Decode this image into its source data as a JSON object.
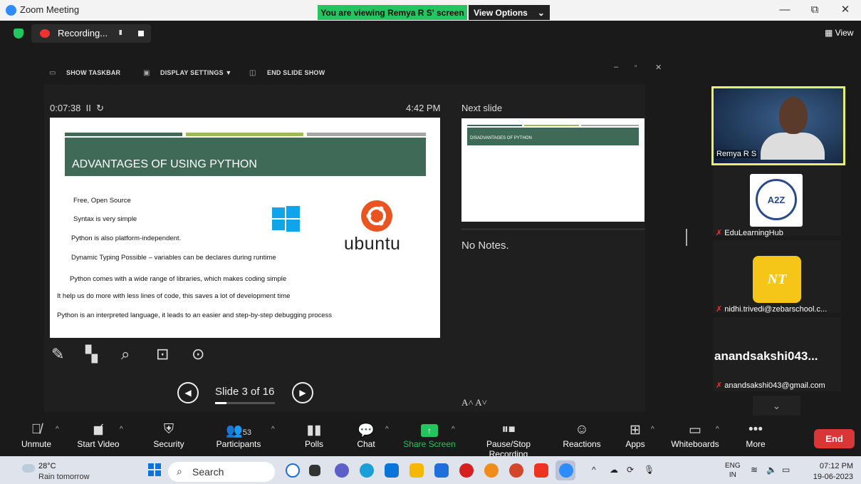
{
  "window": {
    "title": "Zoom Meeting",
    "viewing_banner": "You are viewing Remya R S' screen",
    "view_options": "View Options"
  },
  "recording": {
    "label": "Recording...",
    "pause": "II"
  },
  "view_button": "View",
  "presenter_toolbar": {
    "show_taskbar": "SHOW TASKBAR",
    "display_settings": "DISPLAY SETTINGS ▼",
    "end_slide_show": "END SLIDE SHOW"
  },
  "presenter": {
    "elapsed": "0:07:38",
    "clock": "4:42 PM",
    "next_slide_label": "Next slide",
    "notes": "No Notes.",
    "font_size_control": "A˄ A˅",
    "slide_counter": "Slide 3 of 16",
    "progress_fraction": 0.1875
  },
  "slide": {
    "title": "ADVANTAGES OF USING PYTHON",
    "bullets": [
      "Free, Open Source",
      "Syntax is very simple",
      "Python is also platform-independent.",
      "Dynamic Typing Possible – variables can be declares during runtime",
      "Python comes with a wide range of libraries, which makes coding simple",
      "It help us do more with less lines of code, this saves a lot of development time",
      "Python is an interpreted language, it leads to an easier and step-by-step debugging process"
    ],
    "ubuntu_wordmark": "ubuntu",
    "colors": {
      "title_bar": "#3e6a57",
      "bar1": "#3e6a57",
      "bar2": "#9bbb59",
      "bar3": "#a6a6a6",
      "ubuntu": "#e95420"
    }
  },
  "next_slide": {
    "title": "DISADVANTAGES OF PYTHON"
  },
  "participants": [
    {
      "name": "Remya R S",
      "muted": false
    },
    {
      "name": "EduLearningHub",
      "muted": true,
      "logo_text": "A2Z"
    },
    {
      "name": "nidhi.trivedi@zebarschool.c...",
      "muted": true,
      "initials": "NT"
    },
    {
      "name": "anandsakshi043@gmail.com",
      "muted": true,
      "display": "anandsakshi043..."
    }
  ],
  "toolbar": {
    "unmute": "Unmute",
    "start_video": "Start Video",
    "security": "Security",
    "participants": "Participants",
    "participants_count": "53",
    "polls": "Polls",
    "chat": "Chat",
    "share_screen": "Share Screen",
    "pause_stop_recording": "Pause/Stop Recording",
    "reactions": "Reactions",
    "apps": "Apps",
    "whiteboards": "Whiteboards",
    "more": "More",
    "end": "End",
    "accent_green": "#22c55e",
    "end_red": "#d93636"
  },
  "taskbar": {
    "temp": "28°C",
    "weather": "Rain tomorrow",
    "search": "Search",
    "lang_top": "ENG",
    "lang_bottom": "IN",
    "time": "07:12 PM",
    "date": "19-06-2023"
  }
}
